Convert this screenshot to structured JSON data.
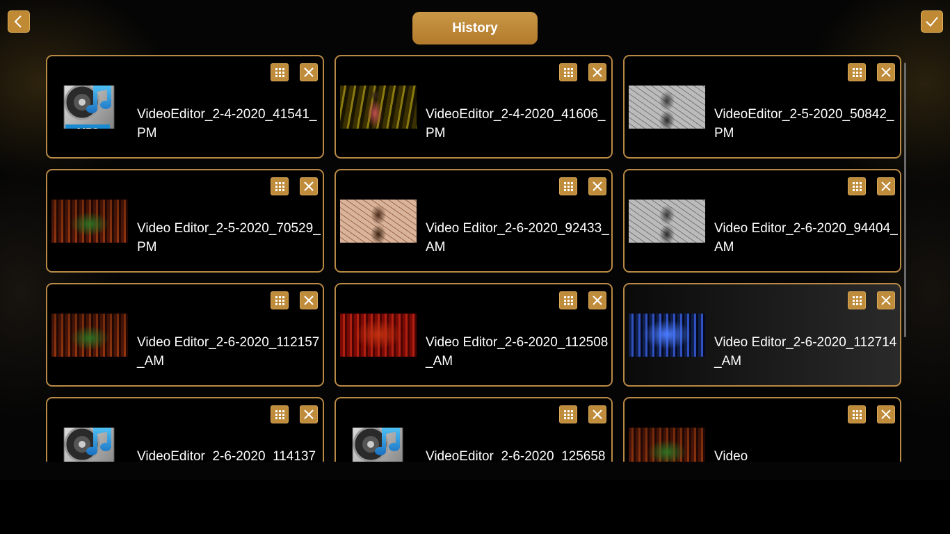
{
  "header": {
    "title": "History",
    "back_icon": "chevron-left-icon",
    "done_icon": "checkmark-icon"
  },
  "colors": {
    "accent": "#c08a35",
    "card_border": "#b98a45",
    "background": "#000000"
  },
  "items": [
    {
      "name": "VideoEditor_2-4-2020_41541_PM",
      "thumb": "mp3"
    },
    {
      "name": "VideoEditor_2-4-2020_41606_PM",
      "thumb": "singer"
    },
    {
      "name": "VideoEditor_2-5-2020_50842_PM",
      "thumb": "crack-gray"
    },
    {
      "name": "Video Editor_2-5-2020_70529_PM",
      "thumb": "stage-green"
    },
    {
      "name": "Video Editor_2-6-2020_92433_AM",
      "thumb": "crack-sepia"
    },
    {
      "name": "Video Editor_2-6-2020_94404_AM",
      "thumb": "crack-gray"
    },
    {
      "name": "Video Editor_2-6-2020_112157_AM",
      "thumb": "stage-green"
    },
    {
      "name": "Video Editor_2-6-2020_112508_AM",
      "thumb": "stage-red"
    },
    {
      "name": "Video Editor_2-6-2020_112714_AM",
      "thumb": "stage-blue",
      "highlighted": true
    },
    {
      "name": "VideoEditor_2-6-2020_114137",
      "thumb": "mp3"
    },
    {
      "name": "VideoEditor_2-6-2020_125658",
      "thumb": "mp3"
    },
    {
      "name": "Video",
      "thumb": "stage-green"
    }
  ],
  "item_actions": {
    "menu_icon": "grid-dots-icon",
    "delete_icon": "close-icon"
  }
}
